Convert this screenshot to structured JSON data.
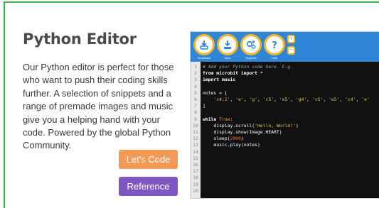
{
  "title": "Python Editor",
  "description": "Our Python editor is perfect for those who want to push their coding skills further. A selection of snippets and a range of premade images and music give you a helping hand with your code. Powered by the global Python Community.",
  "buttons": {
    "lets_code": "Let's Code",
    "reference": "Reference"
  },
  "editor": {
    "tools": [
      {
        "label": "Download",
        "icon": "download-icon"
      },
      {
        "label": "Save",
        "icon": "save-icon"
      },
      {
        "label": "Snippets",
        "icon": "snippets-icon"
      },
      {
        "label": "Help",
        "icon": "help-icon"
      }
    ],
    "zoom_in": "+",
    "zoom_out": "−",
    "code": [
      {
        "n": "1",
        "html": "<span class='cm'># Add your Python code here. E.g.</span>"
      },
      {
        "n": "2",
        "html": "<span class='kw'>from</span> <span class='kw'>microbit</span> <span class='kw'>import</span> *"
      },
      {
        "n": "3",
        "html": "<span class='kw'>import</span> <span class='kw'>music</span>"
      },
      {
        "n": "4",
        "html": ""
      },
      {
        "n": "5",
        "html": "notes = ["
      },
      {
        "n": "6",
        "html": "    <span class='st'>'c4:1'</span>, <span class='st'>'e'</span>, <span class='st'>'g'</span>, <span class='st'>'c5'</span>, <span class='st'>'e5'</span>, <span class='st'>'g4'</span>, <span class='st'>'c5'</span>, <span class='st'>'e5'</span>, <span class='st'>'c4'</span>, <span class='st'>'e'</span>"
      },
      {
        "n": "7",
        "html": "]"
      },
      {
        "n": "8",
        "html": ""
      },
      {
        "n": "9",
        "html": "<span class='kw'>while</span> <span class='kd'>True</span>:"
      },
      {
        "n": "10",
        "html": "    display.scroll(<span class='st'>'Hello, World!'</span>)"
      },
      {
        "n": "11",
        "html": "    display.show(Image.HEART)"
      },
      {
        "n": "12",
        "html": "    sleep(<span class='nm'>2000</span>)"
      },
      {
        "n": "13",
        "html": "    music.play(notes)"
      },
      {
        "n": "14",
        "html": ""
      },
      {
        "n": "15",
        "html": ""
      },
      {
        "n": "16",
        "html": ""
      },
      {
        "n": "17",
        "html": ""
      },
      {
        "n": "18",
        "html": ""
      },
      {
        "n": "19",
        "html": ""
      },
      {
        "n": "20",
        "html": ""
      }
    ]
  },
  "colors": {
    "border": "#3cb54a",
    "lets_code_bg": "#f59a56",
    "reference_bg": "#7e57c2",
    "toolbar_bg": "#2f86d6",
    "tool_ring": "#f4b42b"
  }
}
